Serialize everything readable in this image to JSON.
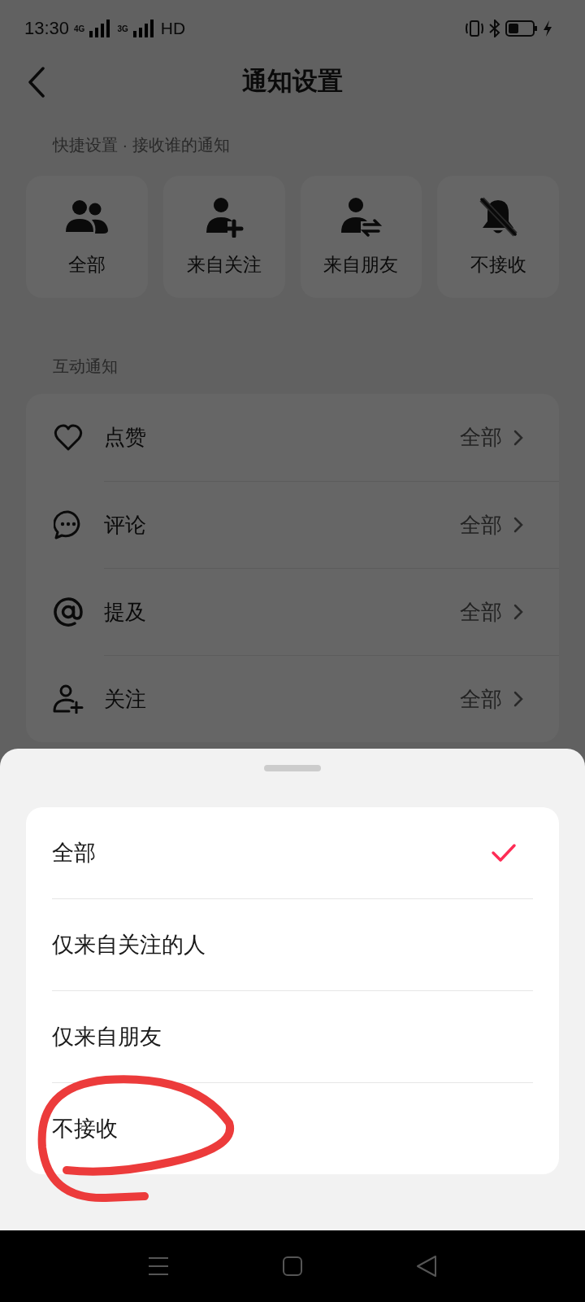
{
  "status_bar": {
    "time": "13:30",
    "sim_1": "4G",
    "sim_2": "3G",
    "network": "HD"
  },
  "header": {
    "title": "通知设置"
  },
  "quick_settings": {
    "label": "快捷设置 · 接收谁的通知",
    "items": [
      {
        "kind": "everyone",
        "label": "全部"
      },
      {
        "kind": "following",
        "label": "来自关注"
      },
      {
        "kind": "friends",
        "label": "来自朋友"
      },
      {
        "kind": "none",
        "label": "不接收"
      }
    ]
  },
  "interaction": {
    "label": "互动通知",
    "rows": [
      {
        "kind": "like",
        "label": "点赞",
        "value": "全部"
      },
      {
        "kind": "comment",
        "label": "评论",
        "value": "全部"
      },
      {
        "kind": "mention",
        "label": "提及",
        "value": "全部"
      },
      {
        "kind": "follow",
        "label": "关注",
        "value": "全部"
      }
    ]
  },
  "sheet": {
    "options": [
      {
        "label": "全部",
        "selected": true
      },
      {
        "label": "仅来自关注的人",
        "selected": false
      },
      {
        "label": "仅来自朋友",
        "selected": false
      },
      {
        "label": "不接收",
        "selected": false
      }
    ]
  }
}
